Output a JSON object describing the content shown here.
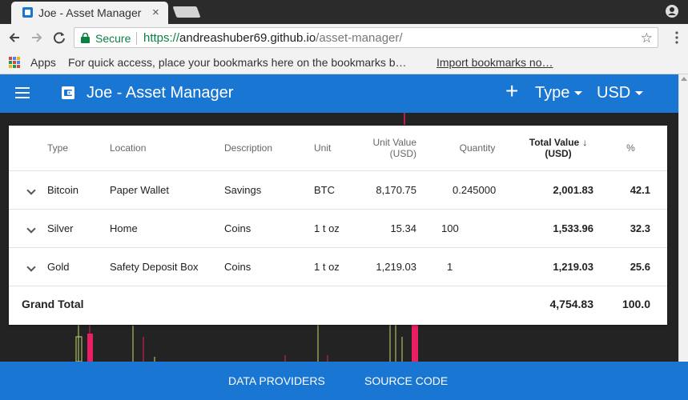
{
  "browser": {
    "tab_title": "Joe - Asset Manager",
    "tab_close": "×",
    "secure_label": "Secure",
    "url_scheme": "https://",
    "url_host": "andreashuber69.github.io",
    "url_path": "/asset-manager/",
    "star": "☆",
    "bookmarks": {
      "apps_label": "Apps",
      "hint": "For quick access, place your bookmarks here on the bookmarks b…",
      "import": "Import bookmarks no…"
    }
  },
  "app": {
    "title": "Joe - Asset Manager",
    "add": "+",
    "type_menu": "Type",
    "currency_menu": "USD",
    "brand_color": "#1976d2"
  },
  "table": {
    "headers": {
      "type": "Type",
      "location": "Location",
      "description": "Description",
      "unit": "Unit",
      "unit_value_1": "Unit Value",
      "unit_value_2": "(USD)",
      "quantity": "Quantity",
      "total_value_1": "Total Value",
      "total_value_2": "(USD)",
      "sort_arrow": "↓",
      "percent": "%"
    },
    "rows": [
      {
        "type": "Bitcoin",
        "location": "Paper Wallet",
        "description": "Savings",
        "unit": "BTC",
        "unit_value": "8,170.75",
        "quantity": "0.245000",
        "total_value": "2,001.83",
        "percent": "42.1"
      },
      {
        "type": "Silver",
        "location": "Home",
        "description": "Coins",
        "unit": "1 t oz",
        "unit_value": "15.34",
        "quantity": "100",
        "total_value": "1,533.96",
        "percent": "32.3"
      },
      {
        "type": "Gold",
        "location": "Safety Deposit Box",
        "description": "Coins",
        "unit": "1 t oz",
        "unit_value": "1,219.03",
        "quantity": "1",
        "total_value": "1,219.03",
        "percent": "25.6"
      }
    ],
    "grand_total": {
      "label": "Grand Total",
      "total_value": "4,754.83",
      "percent": "100.0"
    }
  },
  "footer": {
    "data_providers": "DATA PROVIDERS",
    "source_code": "SOURCE CODE"
  }
}
